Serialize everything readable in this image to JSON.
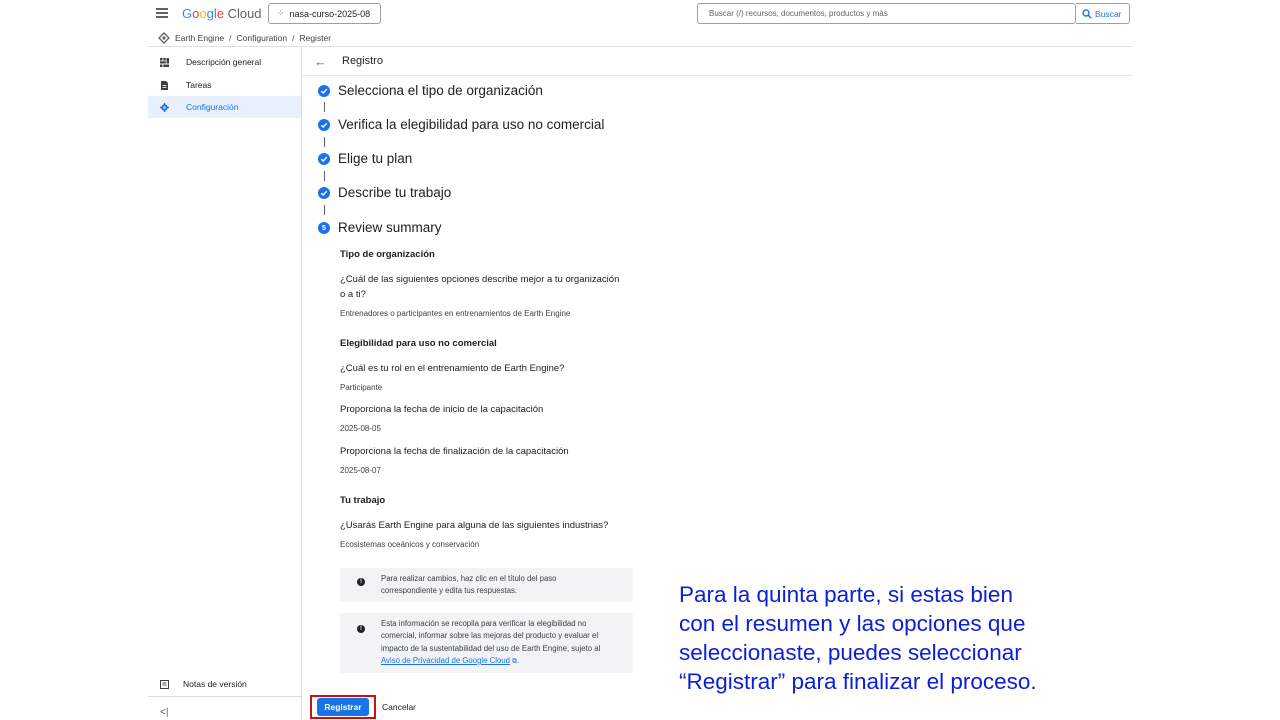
{
  "topbar": {
    "logo_parts": [
      "G",
      "o",
      "o",
      "g",
      "l",
      "e",
      " Cloud"
    ],
    "project_name": "nasa-curso-2025-08",
    "search_placeholder": "Buscar (/) recursos, documentos, productos y más",
    "search_button_label": "Buscar"
  },
  "breadcrumb": [
    "Earth Engine",
    "Configuration",
    "Register"
  ],
  "sidebar": {
    "items": [
      {
        "label": "Descripción general",
        "icon": "dashboard-icon",
        "active": false
      },
      {
        "label": "Tareas",
        "icon": "document-icon",
        "active": false
      },
      {
        "label": "Configuración",
        "icon": "gear-icon",
        "active": true
      }
    ],
    "release_notes_label": "Notas de versión",
    "collapse_label": "<|"
  },
  "main": {
    "title": "Registro",
    "steps": [
      {
        "label": "Selecciona el tipo de organización",
        "status": "done"
      },
      {
        "label": "Verifica la elegibilidad para uso no comercial",
        "status": "done"
      },
      {
        "label": "Elige tu plan",
        "status": "done"
      },
      {
        "label": "Describe tu trabajo",
        "status": "done"
      },
      {
        "label": "Review summary",
        "status": "current",
        "number": "5"
      }
    ],
    "summary": {
      "org_title": "Tipo de organización",
      "org_q_line1": "¿Cuál de las siguientes opciones describe mejor a tu organización",
      "org_q_line2": "o a ti?",
      "org_a": "Entrenadores o participantes en entrenamientos de Earth Engine",
      "elig_title": "Elegibilidad para uso no comercial",
      "role_q": "¿Cuál es tu rol en el entrenamiento de Earth Engine?",
      "role_a": "Participante",
      "start_q": "Proporciona la fecha de inicio de la capacitación",
      "start_a": "2025-08-05",
      "end_q": "Proporciona la fecha de finalización de la capacitación",
      "end_a": "2025-08-07",
      "work_title": "Tu trabajo",
      "work_q": "¿Usarás Earth Engine para alguna de las siguientes industrias?",
      "work_a": "Ecosistemas oceánicos y conservación"
    },
    "info1": {
      "line1": "Para realizar cambios, haz clic en el título del paso",
      "line2": "correspondiente y edita tus respuestas."
    },
    "info2": {
      "line1": "Esta información se recopila para verificar la elegibilidad no",
      "line2": "comercial, informar sobre las mejoras del producto y evaluar el",
      "line3": "impacto de la sustentabilidad del uso de Earth Engine, sujeto al",
      "link": "Aviso de Privacidad de Google Cloud",
      "after_link": "."
    },
    "register_button": "Registrar",
    "cancel_button": "Cancelar"
  },
  "annotation": {
    "line1": "Para la quinta parte, si estas bien",
    "line2": "con el resumen y las opciones que",
    "line3": "seleccionaste, puedes seleccionar",
    "line4": "“Registrar” para finalizar el proceso."
  },
  "colors": {
    "accent": "#1a73e8",
    "highlight": "#d01010",
    "annotation_text": "#0b1ed8"
  }
}
